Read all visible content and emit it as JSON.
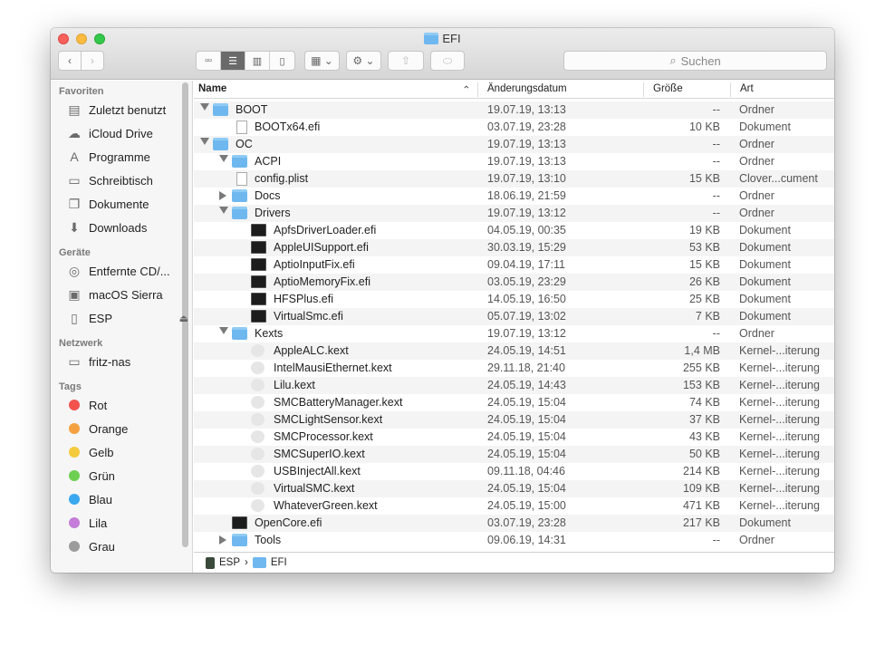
{
  "window": {
    "title": "EFI"
  },
  "toolbar": {
    "search_placeholder": "Suchen"
  },
  "sidebar": {
    "sections": [
      {
        "title": "Favoriten",
        "items": [
          {
            "label": "Zuletzt benutzt",
            "icon": "recents-icon"
          },
          {
            "label": "iCloud Drive",
            "icon": "cloud-icon"
          },
          {
            "label": "Programme",
            "icon": "applications-icon"
          },
          {
            "label": "Schreibtisch",
            "icon": "desktop-icon"
          },
          {
            "label": "Dokumente",
            "icon": "documents-icon"
          },
          {
            "label": "Downloads",
            "icon": "downloads-icon"
          }
        ]
      },
      {
        "title": "Geräte",
        "items": [
          {
            "label": "Entfernte CD/...",
            "icon": "cd-icon"
          },
          {
            "label": "macOS Sierra",
            "icon": "disk-icon"
          },
          {
            "label": "ESP",
            "icon": "drive-icon",
            "eject": true
          }
        ]
      },
      {
        "title": "Netzwerk",
        "items": [
          {
            "label": "fritz-nas",
            "icon": "monitor-icon"
          }
        ]
      },
      {
        "title": "Tags",
        "items": [
          {
            "label": "Rot",
            "color": "#f2534f"
          },
          {
            "label": "Orange",
            "color": "#f5a142"
          },
          {
            "label": "Gelb",
            "color": "#f4cb3e"
          },
          {
            "label": "Grün",
            "color": "#6dcf52"
          },
          {
            "label": "Blau",
            "color": "#3aa8ef"
          },
          {
            "label": "Lila",
            "color": "#c47ed9"
          },
          {
            "label": "Grau",
            "color": "#9c9c9c"
          }
        ]
      }
    ]
  },
  "columns": {
    "name": "Name",
    "date": "Änderungsdatum",
    "size": "Größe",
    "kind": "Art"
  },
  "files": [
    {
      "name": "BOOT",
      "level": 0,
      "type": "folder",
      "expand": "open",
      "date": "19.07.19, 13:13",
      "size": "--",
      "kind": "Ordner"
    },
    {
      "name": "BOOTx64.efi",
      "level": 1,
      "type": "doc",
      "date": "03.07.19, 23:28",
      "size": "10 KB",
      "kind": "Dokument"
    },
    {
      "name": "OC",
      "level": 0,
      "type": "folder",
      "expand": "open",
      "date": "19.07.19, 13:13",
      "size": "--",
      "kind": "Ordner"
    },
    {
      "name": "ACPI",
      "level": 1,
      "type": "folder",
      "expand": "open",
      "date": "19.07.19, 13:13",
      "size": "--",
      "kind": "Ordner"
    },
    {
      "name": "config.plist",
      "level": 1,
      "type": "doc",
      "date": "19.07.19, 13:10",
      "size": "15 KB",
      "kind": "Clover...cument"
    },
    {
      "name": "Docs",
      "level": 1,
      "type": "folder",
      "expand": "closed",
      "date": "18.06.19, 21:59",
      "size": "--",
      "kind": "Ordner"
    },
    {
      "name": "Drivers",
      "level": 1,
      "type": "folder",
      "expand": "open",
      "date": "19.07.19, 13:12",
      "size": "--",
      "kind": "Ordner"
    },
    {
      "name": "ApfsDriverLoader.efi",
      "level": 2,
      "type": "exe",
      "date": "04.05.19, 00:35",
      "size": "19 KB",
      "kind": "Dokument"
    },
    {
      "name": "AppleUISupport.efi",
      "level": 2,
      "type": "exe",
      "date": "30.03.19, 15:29",
      "size": "53 KB",
      "kind": "Dokument"
    },
    {
      "name": "AptioInputFix.efi",
      "level": 2,
      "type": "exe",
      "date": "09.04.19, 17:11",
      "size": "15 KB",
      "kind": "Dokument"
    },
    {
      "name": "AptioMemoryFix.efi",
      "level": 2,
      "type": "exe",
      "date": "03.05.19, 23:29",
      "size": "26 KB",
      "kind": "Dokument"
    },
    {
      "name": "HFSPlus.efi",
      "level": 2,
      "type": "exe",
      "date": "14.05.19, 16:50",
      "size": "25 KB",
      "kind": "Dokument"
    },
    {
      "name": "VirtualSmc.efi",
      "level": 2,
      "type": "exe",
      "date": "05.07.19, 13:02",
      "size": "7 KB",
      "kind": "Dokument"
    },
    {
      "name": "Kexts",
      "level": 1,
      "type": "folder",
      "expand": "open",
      "date": "19.07.19, 13:12",
      "size": "--",
      "kind": "Ordner"
    },
    {
      "name": "AppleALC.kext",
      "level": 2,
      "type": "kext",
      "date": "24.05.19, 14:51",
      "size": "1,4 MB",
      "kind": "Kernel-...iterung"
    },
    {
      "name": "IntelMausiEthernet.kext",
      "level": 2,
      "type": "kext",
      "date": "29.11.18, 21:40",
      "size": "255 KB",
      "kind": "Kernel-...iterung"
    },
    {
      "name": "Lilu.kext",
      "level": 2,
      "type": "kext",
      "date": "24.05.19, 14:43",
      "size": "153 KB",
      "kind": "Kernel-...iterung"
    },
    {
      "name": "SMCBatteryManager.kext",
      "level": 2,
      "type": "kext",
      "date": "24.05.19, 15:04",
      "size": "74 KB",
      "kind": "Kernel-...iterung"
    },
    {
      "name": "SMCLightSensor.kext",
      "level": 2,
      "type": "kext",
      "date": "24.05.19, 15:04",
      "size": "37 KB",
      "kind": "Kernel-...iterung"
    },
    {
      "name": "SMCProcessor.kext",
      "level": 2,
      "type": "kext",
      "date": "24.05.19, 15:04",
      "size": "43 KB",
      "kind": "Kernel-...iterung"
    },
    {
      "name": "SMCSuperIO.kext",
      "level": 2,
      "type": "kext",
      "date": "24.05.19, 15:04",
      "size": "50 KB",
      "kind": "Kernel-...iterung"
    },
    {
      "name": "USBInjectAll.kext",
      "level": 2,
      "type": "kext",
      "date": "09.11.18, 04:46",
      "size": "214 KB",
      "kind": "Kernel-...iterung"
    },
    {
      "name": "VirtualSMC.kext",
      "level": 2,
      "type": "kext",
      "date": "24.05.19, 15:04",
      "size": "109 KB",
      "kind": "Kernel-...iterung"
    },
    {
      "name": "WhateverGreen.kext",
      "level": 2,
      "type": "kext",
      "date": "24.05.19, 15:00",
      "size": "471 KB",
      "kind": "Kernel-...iterung"
    },
    {
      "name": "OpenCore.efi",
      "level": 1,
      "type": "exe",
      "date": "03.07.19, 23:28",
      "size": "217 KB",
      "kind": "Dokument"
    },
    {
      "name": "Tools",
      "level": 1,
      "type": "folder",
      "expand": "closed",
      "date": "09.06.19, 14:31",
      "size": "--",
      "kind": "Ordner"
    }
  ],
  "pathbar": {
    "items": [
      "ESP",
      "EFI"
    ],
    "separator": "›"
  }
}
